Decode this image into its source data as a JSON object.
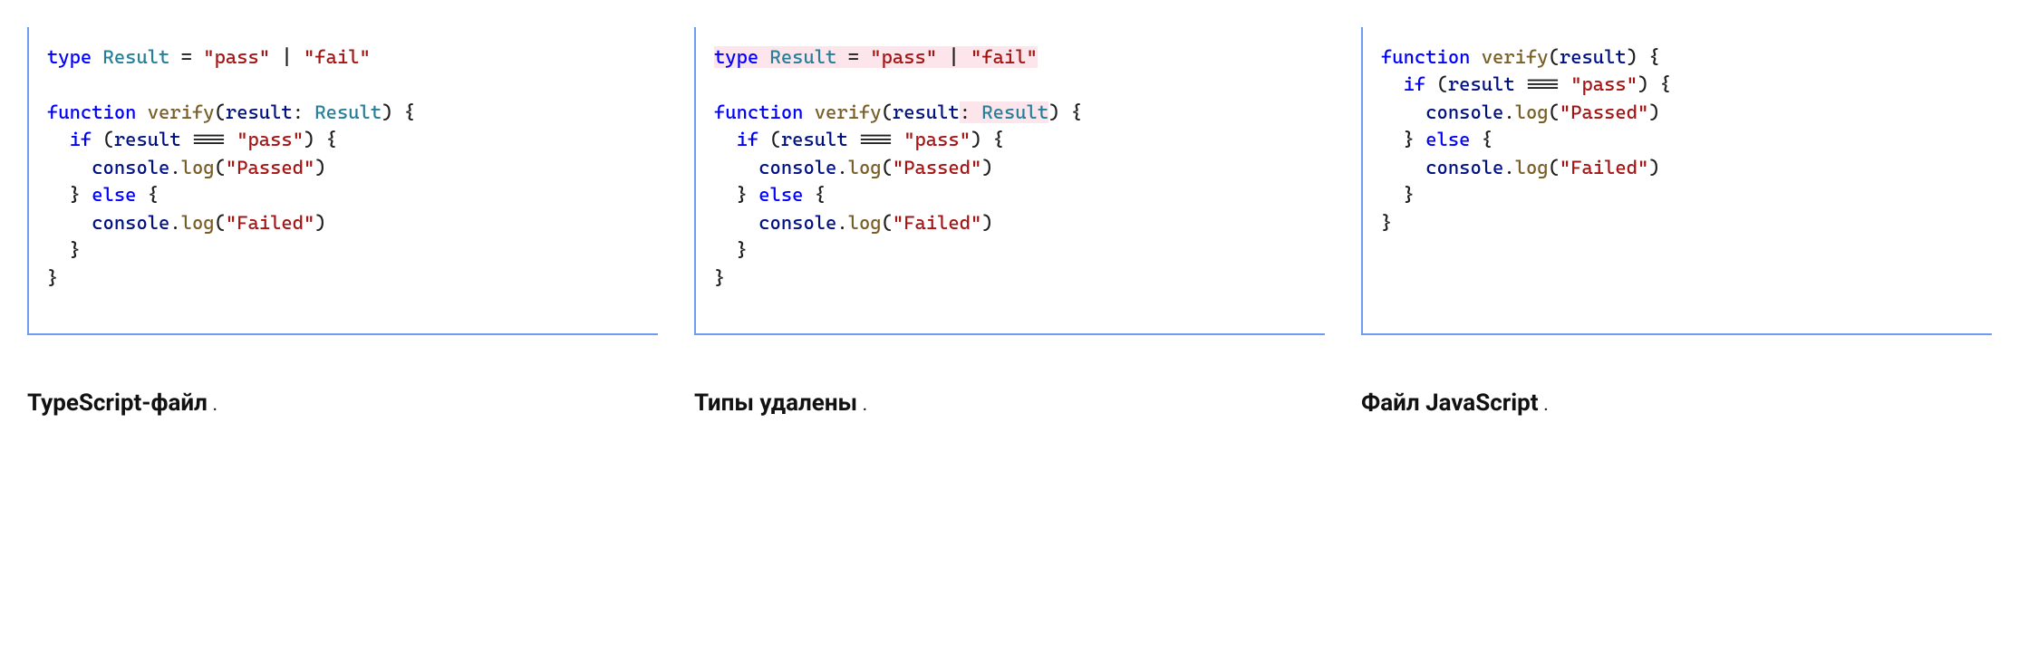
{
  "captions": {
    "col1": "TypeScript-файл",
    "col2": "Типы удалены",
    "col3": "Файл JavaScript",
    "sep": " ."
  },
  "code": {
    "col1": [
      {
        "cls": "kw",
        "t": "type"
      },
      {
        "cls": "",
        "t": " "
      },
      {
        "cls": "type",
        "t": "Result"
      },
      {
        "cls": "",
        "t": " = "
      },
      {
        "cls": "str",
        "t": "\"pass\""
      },
      {
        "cls": "",
        "t": " | "
      },
      {
        "cls": "str",
        "t": "\"fail\""
      },
      {
        "nl": true
      },
      {
        "nl": true
      },
      {
        "cls": "kw",
        "t": "function"
      },
      {
        "cls": "",
        "t": " "
      },
      {
        "cls": "fn",
        "t": "verify"
      },
      {
        "cls": "",
        "t": "("
      },
      {
        "cls": "id",
        "t": "result"
      },
      {
        "cls": "",
        "t": ": "
      },
      {
        "cls": "type",
        "t": "Result"
      },
      {
        "cls": "",
        "t": ") {"
      },
      {
        "nl": true
      },
      {
        "cls": "",
        "t": "  "
      },
      {
        "cls": "kw",
        "t": "if"
      },
      {
        "cls": "",
        "t": " ("
      },
      {
        "cls": "id",
        "t": "result"
      },
      {
        "cls": "",
        "t": " === "
      },
      {
        "cls": "str",
        "t": "\"pass\""
      },
      {
        "cls": "",
        "t": ") {"
      },
      {
        "nl": true
      },
      {
        "cls": "",
        "t": "    "
      },
      {
        "cls": "id",
        "t": "console"
      },
      {
        "cls": "",
        "t": "."
      },
      {
        "cls": "fn",
        "t": "log"
      },
      {
        "cls": "",
        "t": "("
      },
      {
        "cls": "str",
        "t": "\"Passed\""
      },
      {
        "cls": "",
        "t": ")"
      },
      {
        "nl": true
      },
      {
        "cls": "",
        "t": "  } "
      },
      {
        "cls": "kw",
        "t": "else"
      },
      {
        "cls": "",
        "t": " {"
      },
      {
        "nl": true
      },
      {
        "cls": "",
        "t": "    "
      },
      {
        "cls": "id",
        "t": "console"
      },
      {
        "cls": "",
        "t": "."
      },
      {
        "cls": "fn",
        "t": "log"
      },
      {
        "cls": "",
        "t": "("
      },
      {
        "cls": "str",
        "t": "\"Failed\""
      },
      {
        "cls": "",
        "t": ")"
      },
      {
        "nl": true
      },
      {
        "cls": "",
        "t": "  }"
      },
      {
        "nl": true
      },
      {
        "cls": "",
        "t": "}"
      }
    ],
    "col2": [
      {
        "cls": "kw",
        "bg": "del",
        "t": "type"
      },
      {
        "cls": "",
        "bg": "del",
        "t": " "
      },
      {
        "cls": "type",
        "bg": "del",
        "t": "Result"
      },
      {
        "cls": "",
        "bg": "del",
        "t": " = "
      },
      {
        "cls": "str",
        "bg": "del",
        "t": "\"pass\""
      },
      {
        "cls": "",
        "bg": "del",
        "t": " | "
      },
      {
        "cls": "str",
        "bg": "del",
        "t": "\"fail\""
      },
      {
        "nl": true
      },
      {
        "nl": true
      },
      {
        "cls": "kw",
        "t": "function"
      },
      {
        "cls": "",
        "t": " "
      },
      {
        "cls": "fn",
        "t": "verify"
      },
      {
        "cls": "",
        "t": "("
      },
      {
        "cls": "id",
        "t": "result"
      },
      {
        "cls": "",
        "bg": "del",
        "t": ": "
      },
      {
        "cls": "type",
        "bg": "del",
        "t": "Result"
      },
      {
        "cls": "",
        "t": ") {"
      },
      {
        "nl": true
      },
      {
        "cls": "",
        "t": "  "
      },
      {
        "cls": "kw",
        "t": "if"
      },
      {
        "cls": "",
        "t": " ("
      },
      {
        "cls": "id",
        "t": "result"
      },
      {
        "cls": "",
        "t": " === "
      },
      {
        "cls": "str",
        "t": "\"pass\""
      },
      {
        "cls": "",
        "t": ") {"
      },
      {
        "nl": true
      },
      {
        "cls": "",
        "t": "    "
      },
      {
        "cls": "id",
        "t": "console"
      },
      {
        "cls": "",
        "t": "."
      },
      {
        "cls": "fn",
        "t": "log"
      },
      {
        "cls": "",
        "t": "("
      },
      {
        "cls": "str",
        "t": "\"Passed\""
      },
      {
        "cls": "",
        "t": ")"
      },
      {
        "nl": true
      },
      {
        "cls": "",
        "t": "  } "
      },
      {
        "cls": "kw",
        "t": "else"
      },
      {
        "cls": "",
        "t": " {"
      },
      {
        "nl": true
      },
      {
        "cls": "",
        "t": "    "
      },
      {
        "cls": "id",
        "t": "console"
      },
      {
        "cls": "",
        "t": "."
      },
      {
        "cls": "fn",
        "t": "log"
      },
      {
        "cls": "",
        "t": "("
      },
      {
        "cls": "str",
        "t": "\"Failed\""
      },
      {
        "cls": "",
        "t": ")"
      },
      {
        "nl": true
      },
      {
        "cls": "",
        "t": "  }"
      },
      {
        "nl": true
      },
      {
        "cls": "",
        "t": "}"
      }
    ],
    "col3": [
      {
        "cls": "kw",
        "t": "function"
      },
      {
        "cls": "",
        "t": " "
      },
      {
        "cls": "fn",
        "t": "verify"
      },
      {
        "cls": "",
        "t": "("
      },
      {
        "cls": "id",
        "t": "result"
      },
      {
        "cls": "",
        "t": ") {"
      },
      {
        "nl": true
      },
      {
        "cls": "",
        "t": "  "
      },
      {
        "cls": "kw",
        "t": "if"
      },
      {
        "cls": "",
        "t": " ("
      },
      {
        "cls": "id",
        "t": "result"
      },
      {
        "cls": "",
        "t": " === "
      },
      {
        "cls": "str",
        "t": "\"pass\""
      },
      {
        "cls": "",
        "t": ") {"
      },
      {
        "nl": true
      },
      {
        "cls": "",
        "t": "    "
      },
      {
        "cls": "id",
        "t": "console"
      },
      {
        "cls": "",
        "t": "."
      },
      {
        "cls": "fn",
        "t": "log"
      },
      {
        "cls": "",
        "t": "("
      },
      {
        "cls": "str",
        "t": "\"Passed\""
      },
      {
        "cls": "",
        "t": ")"
      },
      {
        "nl": true
      },
      {
        "cls": "",
        "t": "  } "
      },
      {
        "cls": "kw",
        "t": "else"
      },
      {
        "cls": "",
        "t": " {"
      },
      {
        "nl": true
      },
      {
        "cls": "",
        "t": "    "
      },
      {
        "cls": "id",
        "t": "console"
      },
      {
        "cls": "",
        "t": "."
      },
      {
        "cls": "fn",
        "t": "log"
      },
      {
        "cls": "",
        "t": "("
      },
      {
        "cls": "str",
        "t": "\"Failed\""
      },
      {
        "cls": "",
        "t": ")"
      },
      {
        "nl": true
      },
      {
        "cls": "",
        "t": "  }"
      },
      {
        "nl": true
      },
      {
        "cls": "",
        "t": "}"
      }
    ]
  }
}
